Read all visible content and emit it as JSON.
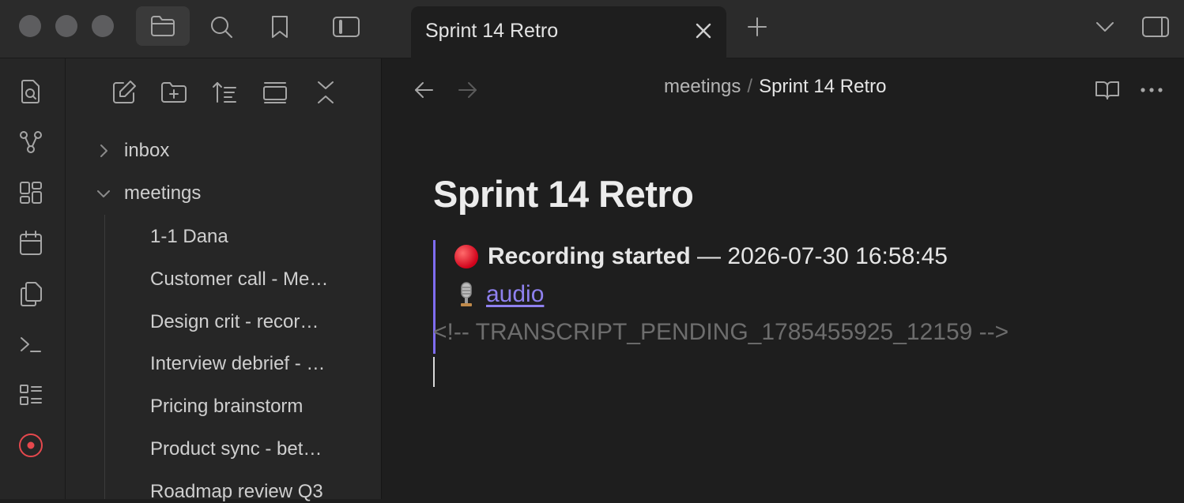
{
  "tab": {
    "title": "Sprint 14 Retro"
  },
  "sidebar": {
    "folders": [
      {
        "label": "inbox",
        "expanded": false
      },
      {
        "label": "meetings",
        "expanded": true
      }
    ],
    "files": [
      "1-1 Dana",
      "Customer call - Me…",
      "Design crit - recor…",
      "Interview debrief - …",
      "Pricing brainstorm",
      "Product sync - bet…",
      "Roadmap review Q3"
    ]
  },
  "breadcrumb": {
    "folder": "meetings",
    "separator": "/",
    "current": "Sprint 14 Retro"
  },
  "note": {
    "title": "Sprint 14 Retro",
    "recording_label": "Recording started",
    "recording_dash": " — ",
    "recording_time": "2026-07-30 16:58:45",
    "audio_link": "audio",
    "transcript_comment": "<!-- TRANSCRIPT_PENDING_1785455925_12159 -->"
  },
  "colors": {
    "accent": "#7f6df2",
    "link": "#8f81ef",
    "record": "#e5484d"
  },
  "icons": {
    "ribbon": [
      "search-file-icon",
      "graph-icon",
      "canvas-icon",
      "calendar-icon",
      "copy-icon",
      "terminal-icon",
      "list-icon",
      "record-icon"
    ],
    "sidebar_tools": [
      "new-note-icon",
      "new-folder-icon",
      "sort-icon",
      "collapse-view-icon",
      "collapse-all-icon"
    ]
  }
}
